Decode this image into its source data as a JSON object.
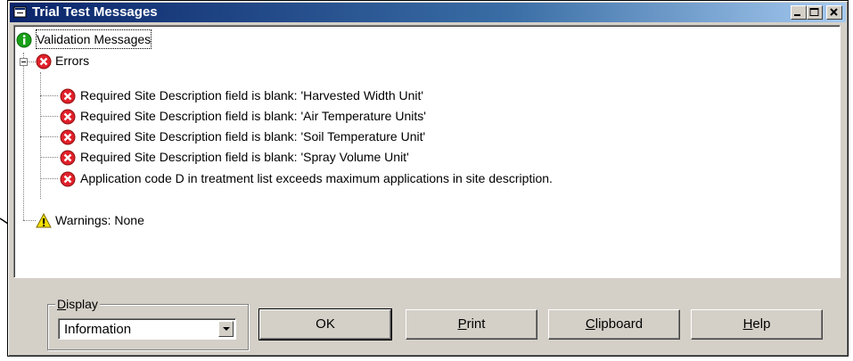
{
  "window": {
    "title": "Trial Test Messages"
  },
  "tree": {
    "root": {
      "label": "Validation Messages",
      "icon": "info-icon"
    },
    "errors": {
      "label": "Errors",
      "icon": "error-icon",
      "items": [
        "Required Site Description field is blank: 'Harvested Width Unit'",
        "Required Site Description field is blank: 'Air Temperature Units'",
        "Required Site Description field is blank: 'Soil Temperature Unit'",
        "Required Site Description field is blank: 'Spray Volume Unit'",
        "Application code D in treatment list exceeds maximum applications in site description."
      ]
    },
    "warnings": {
      "label": "Warnings: None",
      "icon": "warning-icon"
    }
  },
  "display": {
    "legend_first": "D",
    "legend_rest": "isplay",
    "selected": "Information"
  },
  "buttons": {
    "ok": {
      "label": "OK"
    },
    "print": {
      "first": "P",
      "rest": "rint"
    },
    "clipboard": {
      "first": "C",
      "rest": "lipboard"
    },
    "help": {
      "first": "H",
      "rest": "elp"
    }
  },
  "colors": {
    "error": "#e0202a",
    "info": "#18a018",
    "warning": "#f5e000",
    "title_start": "#0a246a",
    "title_end": "#a6caf0"
  }
}
